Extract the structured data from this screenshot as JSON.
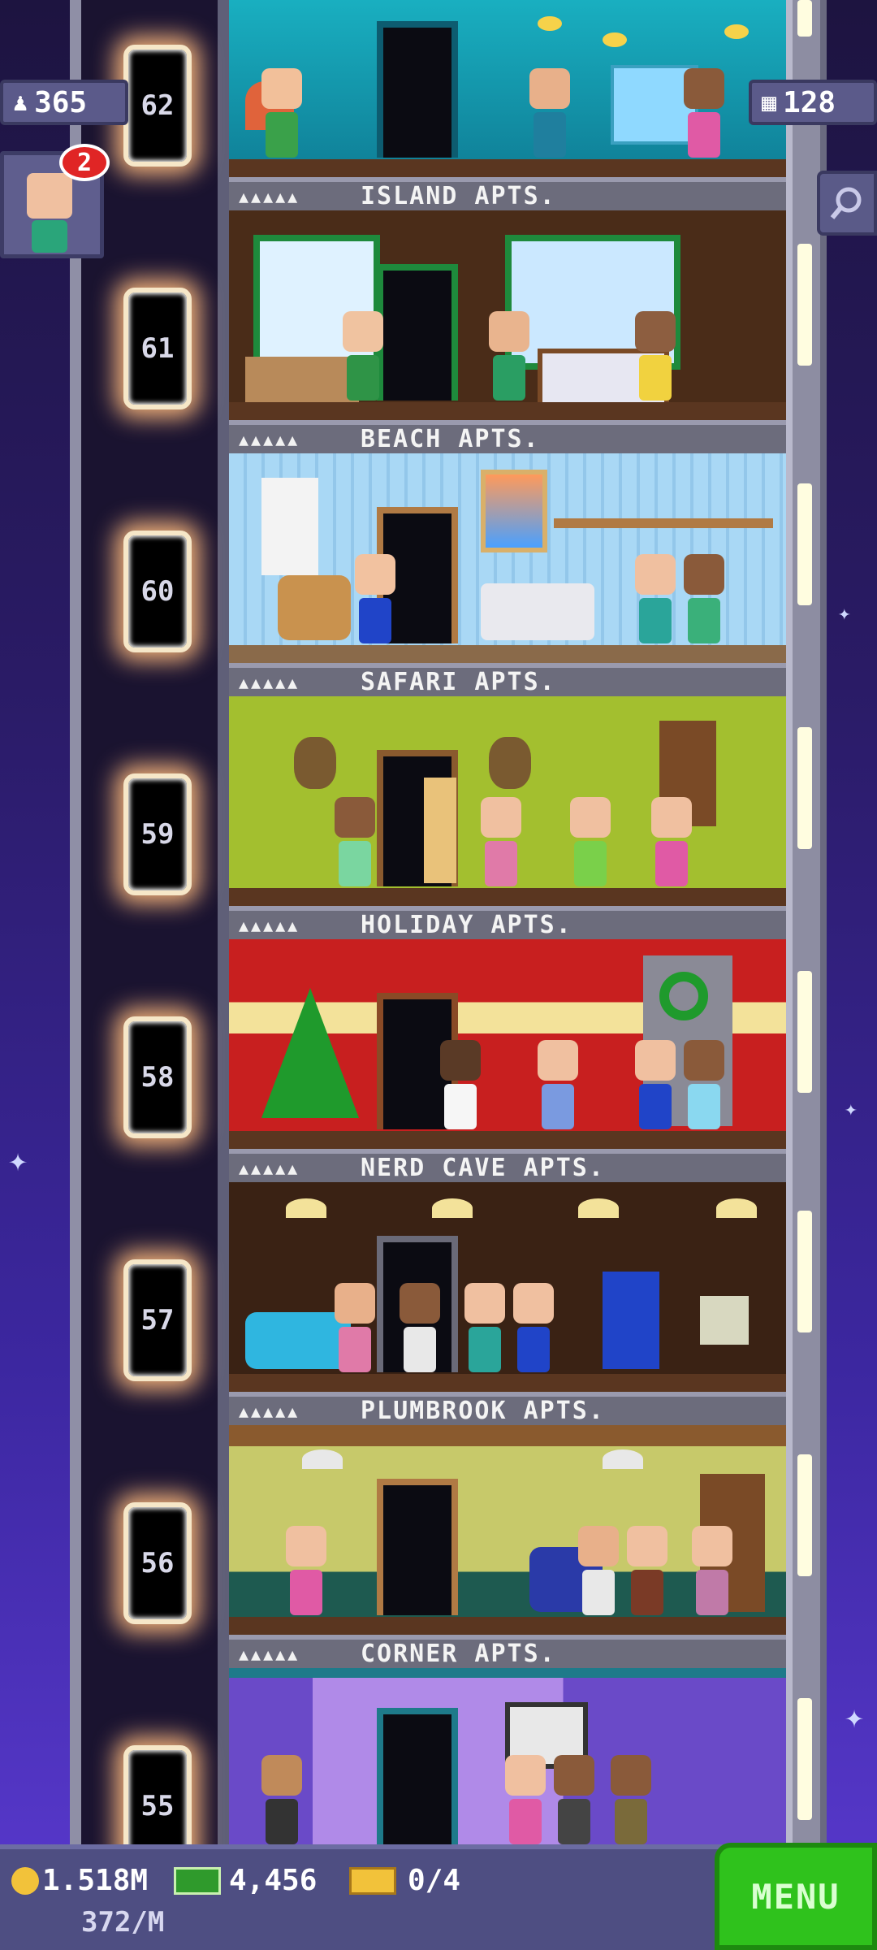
{
  "header": {
    "population": "365",
    "floors_count": "128",
    "notification_count": "2"
  },
  "elevator": {
    "floor_numbers": [
      "62",
      "61",
      "60",
      "59",
      "58",
      "57",
      "56",
      "55"
    ]
  },
  "floors": [
    {
      "label": "ISLAND APTS.",
      "stars": "▲▲▲▲▲"
    },
    {
      "label": "BEACH APTS.",
      "stars": "▲▲▲▲▲"
    },
    {
      "label": "SAFARI APTS.",
      "stars": "▲▲▲▲▲"
    },
    {
      "label": "HOLIDAY APTS.",
      "stars": "▲▲▲▲▲"
    },
    {
      "label": "NERD CAVE APTS.",
      "stars": "▲▲▲▲▲"
    },
    {
      "label": "PLUMBROOK APTS.",
      "stars": "▲▲▲▲▲"
    },
    {
      "label": "CORNER APTS.",
      "stars": "▲▲▲▲▲"
    }
  ],
  "bottom": {
    "coins": "1.518M",
    "coin_rate": "372/M",
    "bux": "4,456",
    "tickets": "0/4",
    "menu_label": "MENU"
  },
  "icons": {
    "population": "person-icon",
    "floors": "building-icon",
    "search": "magnifier-icon",
    "coin": "coin-icon",
    "bux": "cash-icon",
    "ticket": "ticket-icon"
  }
}
